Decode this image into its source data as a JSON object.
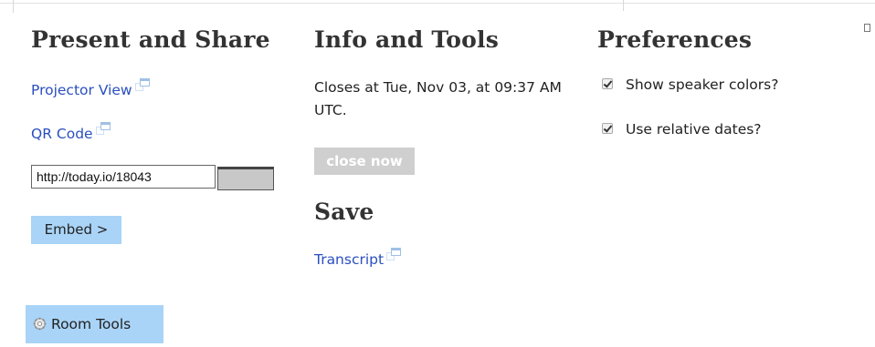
{
  "present": {
    "title": "Present and Share",
    "projector_view": "Projector View",
    "qr_code": "QR Code",
    "share_url": "http://today.io/18043",
    "embed_label": "Embed >"
  },
  "info": {
    "title": "Info and Tools",
    "closes_text": "Closes at Tue, Nov 03, at 09:37 AM UTC.",
    "close_now_label": "close now",
    "save_title": "Save",
    "transcript": "Transcript"
  },
  "preferences": {
    "title": "Preferences",
    "options": [
      {
        "label": "Show speaker colors?",
        "checked": true
      },
      {
        "label": "Use relative dates?",
        "checked": true
      }
    ]
  },
  "room_tools": {
    "label": "Room Tools"
  },
  "icons": {
    "external": "external-link-icon",
    "gear": "gear-icon"
  },
  "colors": {
    "link": "#2a4fbf",
    "button_blue": "#a9d4f7",
    "button_disabled": "#cfcfcf"
  }
}
